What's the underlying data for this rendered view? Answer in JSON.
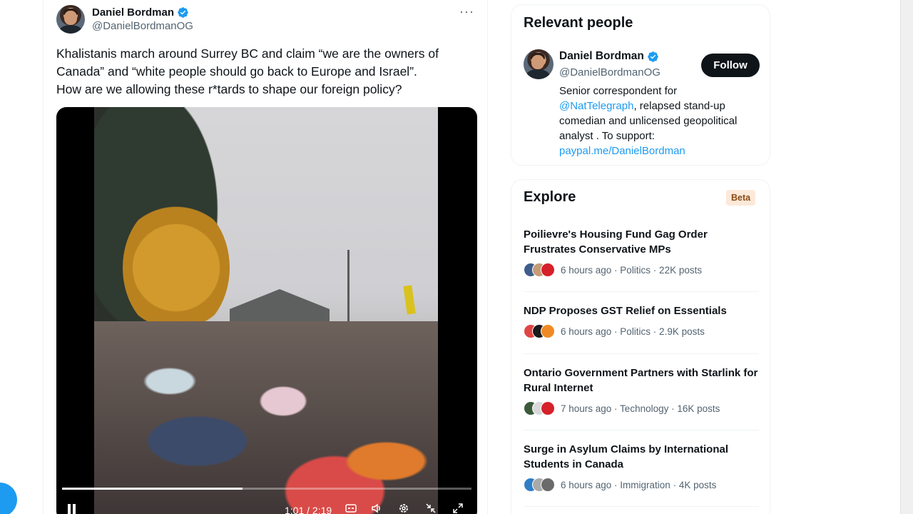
{
  "tweet": {
    "author_name": "Daniel Bordman",
    "author_handle": "@DanielBordmanOG",
    "more_label": "···",
    "text_lines": [
      "Khalistanis march around Surrey BC and claim “we are the owners of",
      "Canada” and “white people should go back to Europe and Israel”.",
      "How are we allowing these r*tards to shape our foreign policy?"
    ],
    "video": {
      "time_display": "1:01 / 2:19",
      "progress": 0.44,
      "icons": [
        "pause-icon",
        "captions-icon",
        "volume-icon",
        "settings-icon",
        "minimize-icon",
        "fullscreen-icon"
      ]
    }
  },
  "relevant_people": {
    "title": "Relevant people",
    "name": "Daniel Bordman",
    "handle": "@DanielBordmanOG",
    "follow_label": "Follow",
    "bio_before": "Senior correspondent for",
    "bio_link": "@NatTelegraph",
    "bio_after": ", relapsed stand-up comedian and unlicensed geopolitical analyst . To support:",
    "bio_url": "paypal.me/DanielBordman"
  },
  "explore": {
    "title": "Explore",
    "badge": "Beta",
    "items": [
      {
        "title": "Poilievre's Housing Fund Gag Order Frustrates Conservative MPs",
        "meta": "6 hours ago · Politics · 22K posts"
      },
      {
        "title": "NDP Proposes GST Relief on Essentials",
        "meta": "6 hours ago · Politics · 2.9K posts"
      },
      {
        "title": "Ontario Government Partners with Starlink for Rural Internet",
        "meta": "7 hours ago · Technology · 16K posts"
      },
      {
        "title": "Surge in Asylum Claims by International Students in Canada",
        "meta": "6 hours ago · Immigration · 4K posts"
      }
    ]
  },
  "colors": {
    "accent": "#1d9bf0",
    "text": "#0f1419",
    "muted": "#536471",
    "follow_bg": "#0f1419",
    "beta_bg": "#fde9d9"
  }
}
